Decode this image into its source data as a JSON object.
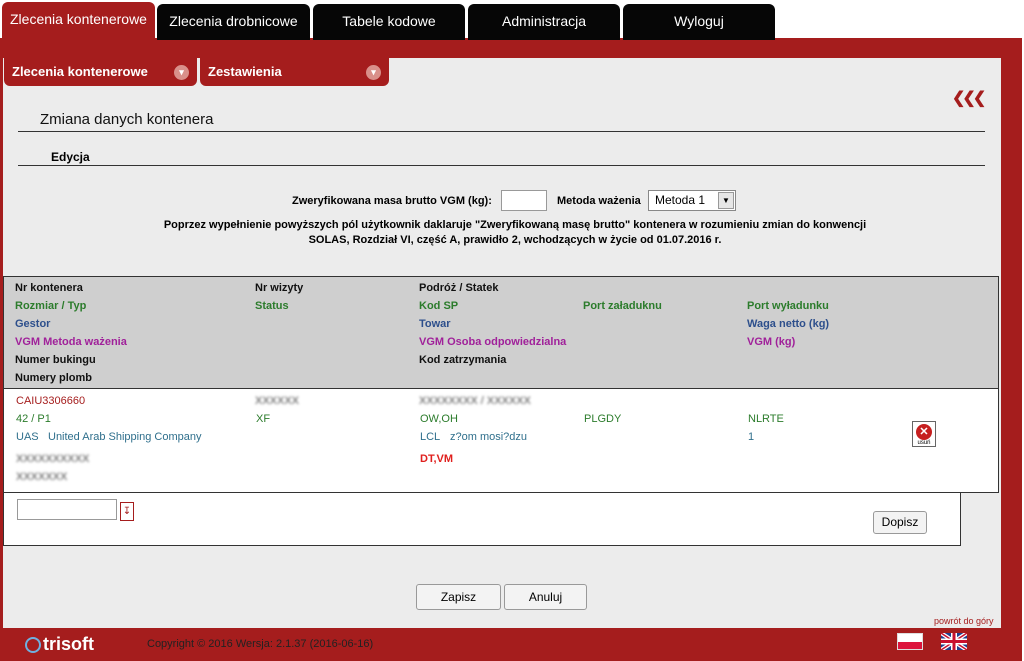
{
  "top_tabs": [
    {
      "label": "Zlecenia kontenerowe",
      "active": true
    },
    {
      "label": "Zlecenia drobnicowe",
      "active": false
    },
    {
      "label": "Tabele kodowe",
      "active": false
    },
    {
      "label": "Administracja",
      "active": false
    },
    {
      "label": "Wyloguj",
      "active": false
    }
  ],
  "sub_tabs": [
    {
      "label": "Zlecenia kontenerowe"
    },
    {
      "label": "Zestawienia"
    }
  ],
  "page_title": "Zmiana danych kontenera",
  "section_title": "Edycja",
  "vgm": {
    "mass_label": "Zweryfikowana masa brutto VGM (kg):",
    "mass_value": "",
    "method_label": "Metoda ważenia",
    "method_selected": "Metoda 1",
    "declaration_line1": "Poprzez wypełnienie powyższych pól użytkownik daklaruje \"Zweryfikowaną masę brutto\" kontenera w rozumieniu zmian do konwencji",
    "declaration_line2": "SOLAS, Rozdział VI, część A, prawidło 2, wchodzących w życie od 01.07.2016 r."
  },
  "table_headers": {
    "nr_kontenera": "Nr kontenera",
    "nr_wizyty": "Nr wizyty",
    "podroz_statek": "Podróż / Statek",
    "rozmiar_typ": "Rozmiar / Typ",
    "status": "Status",
    "kod_sp": "Kod SP",
    "port_zaladunku": "Port załaduknu",
    "port_wyladunku": "Port wyładunku",
    "gestor": "Gestor",
    "towar": "Towar",
    "waga_netto": "Waga netto (kg)",
    "vgm_metoda": "VGM Metoda ważenia",
    "vgm_osoba": "VGM Osoba odpowiedzialna",
    "vgm_kg": "VGM (kg)",
    "numer_bukingu": "Numer bukingu",
    "kod_zatrzymania": "Kod zatrzymania",
    "numery_plomb": "Numery plomb"
  },
  "row": {
    "nr_kontenera": "CAIU3306660",
    "nr_wizyty": "XXXXXX",
    "podroz_statek": "XXXXXXXX / XXXXXX",
    "rozmiar_typ": "42 / P1",
    "status": "XF",
    "kod_sp": "OW,OH",
    "port_zaladunku": "PLGDY",
    "port_wyladunku": "NLRTE",
    "gestor_code": "UAS",
    "gestor_name": "United Arab Shipping Company",
    "towar_code": "LCL",
    "towar_name": "z?om mosi?dzu",
    "waga_netto": "1",
    "numer_bukingu": "XXXXXXXXXX",
    "kod_zatrzymania": "DT,VM",
    "numery_plomb": "XXXXXXX",
    "delete_label": "usuń"
  },
  "seal_add_label": "Dopisz",
  "buttons": {
    "save": "Zapisz",
    "cancel": "Anuluj"
  },
  "back_to_top": "powrót do góry",
  "footer": {
    "logo_text": "trisoft",
    "copyright": "Copyright © 2016   Wersja: 2.1.37 (2016-06-16)"
  },
  "colors": {
    "brand_red": "#a51d1d",
    "tab_dark": "#060606",
    "panel_bg": "#ececec",
    "header_bg": "#cfcfcf"
  }
}
